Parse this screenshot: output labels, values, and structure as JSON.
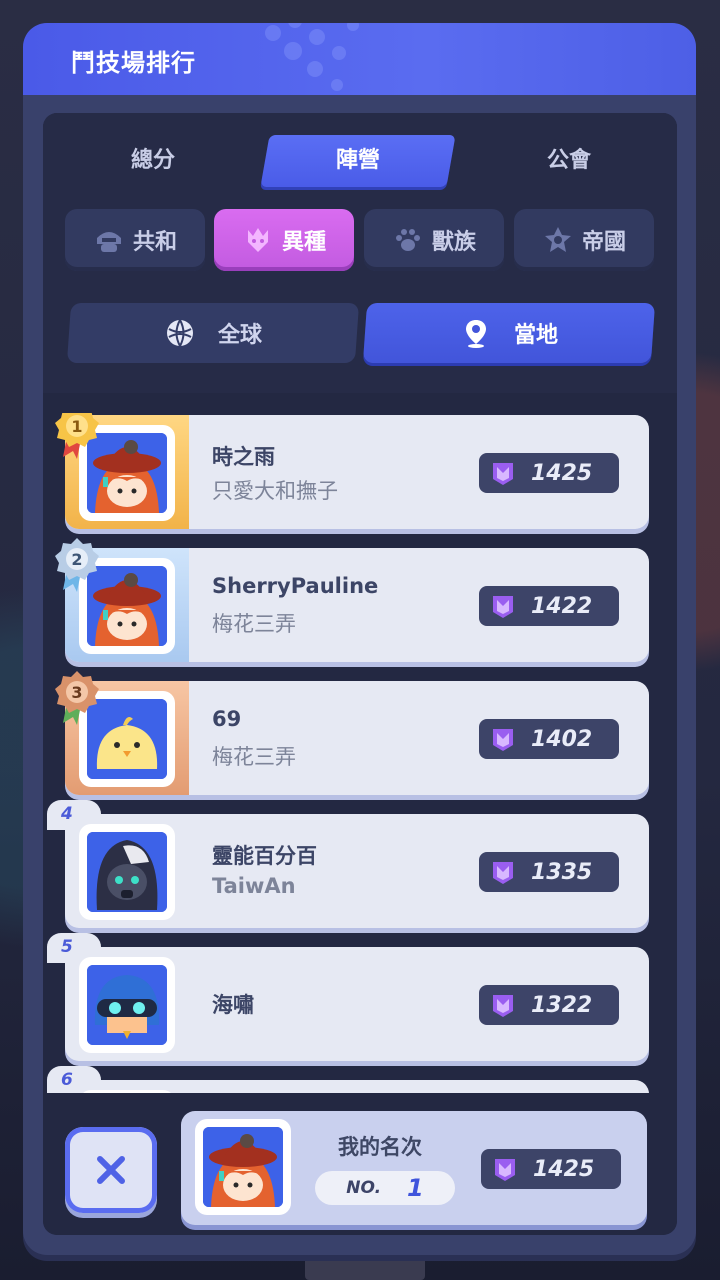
{
  "panel": {
    "title": "鬥技場排行"
  },
  "tabs": [
    {
      "label": "總分",
      "active": false
    },
    {
      "label": "陣營",
      "active": true
    },
    {
      "label": "公會",
      "active": false
    }
  ],
  "factions": [
    {
      "label": "共和",
      "icon": "republic-icon",
      "active": false
    },
    {
      "label": "異種",
      "icon": "xeno-icon",
      "active": true
    },
    {
      "label": "獸族",
      "icon": "paw-icon",
      "active": false
    },
    {
      "label": "帝國",
      "icon": "empire-icon",
      "active": false
    }
  ],
  "scopes": [
    {
      "label": "全球",
      "icon": "globe-icon",
      "active": false
    },
    {
      "label": "當地",
      "icon": "location-pin-icon",
      "active": true
    }
  ],
  "rankings": [
    {
      "rank": "1",
      "name": "時之雨",
      "guild": "只愛大和撫子",
      "score": "1425"
    },
    {
      "rank": "2",
      "name": "SherryPauline",
      "guild": "梅花三弄",
      "score": "1422"
    },
    {
      "rank": "3",
      "name": "69",
      "guild": "梅花三弄",
      "score": "1402"
    },
    {
      "rank": "4",
      "name": "靈能百分百",
      "guild": "TaiwAn",
      "score": "1335"
    },
    {
      "rank": "5",
      "name": "海嘯",
      "guild": "",
      "score": "1322"
    },
    {
      "rank": "6"
    }
  ],
  "my_rank": {
    "label": "我的名次",
    "no_label": "NO.",
    "number": "1",
    "score": "1425"
  },
  "colors": {
    "header": "#5a6cf0",
    "panel": "#39416b",
    "active_faction": "#d96cf0",
    "gold": "#f2b349",
    "silver": "#a9c9f0",
    "bronze": "#e39c72"
  }
}
